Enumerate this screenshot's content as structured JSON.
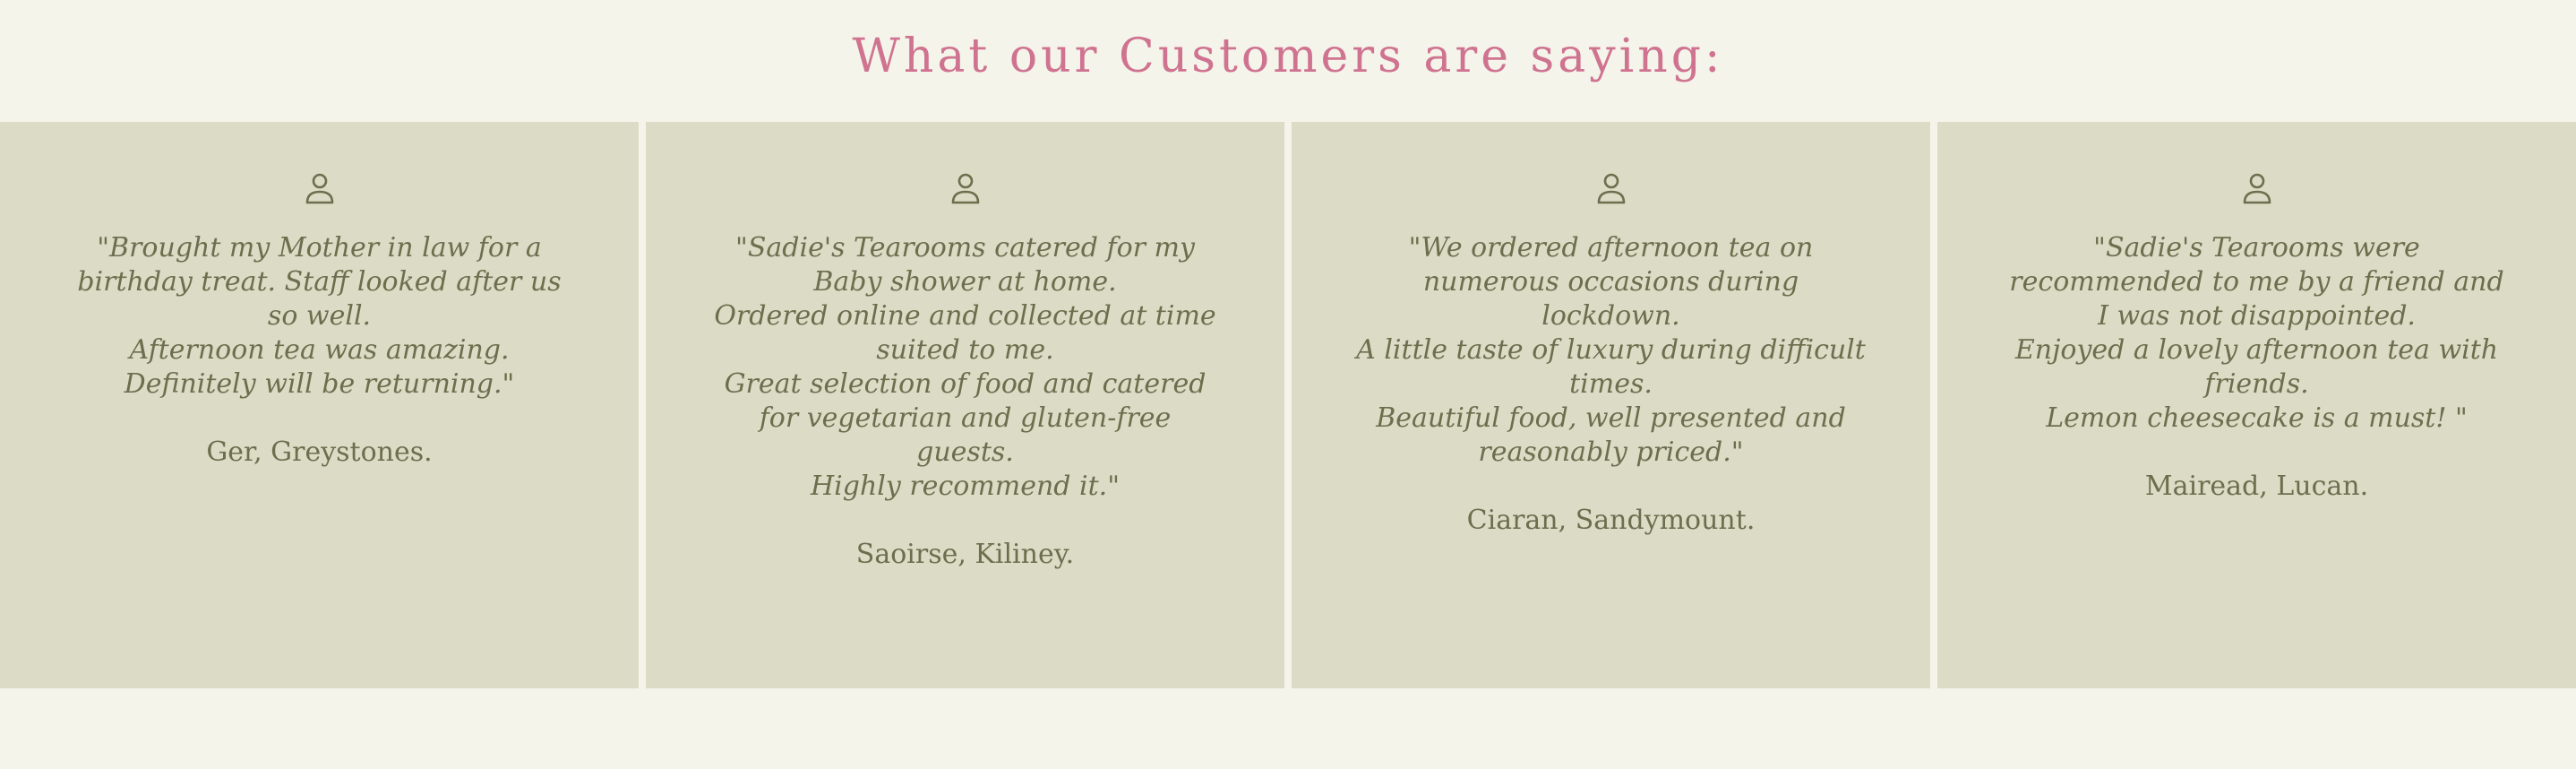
{
  "heading": "What our Customers are saying:",
  "colors": {
    "background": "#f4f4ea",
    "card_background": "#dcdbc5",
    "heading": "#cf7390",
    "text": "#6b6f4e"
  },
  "testimonials": [
    {
      "icon": "user-icon",
      "quote": "\"Brought my Mother in law for a birthday treat. Staff looked after us so well.\nAfternoon tea was amazing. Definitely will be returning.\"",
      "author": "Ger, Greystones."
    },
    {
      "icon": "user-icon",
      "quote": "\"Sadie's Tearooms catered for my Baby shower at home.\nOrdered online and collected at time suited to me.\nGreat selection of food and catered for vegetarian and gluten-free guests.\nHighly recommend it.\"",
      "author": "Saoirse, Kiliney."
    },
    {
      "icon": "user-icon",
      "quote": "\"We ordered afternoon tea on numerous occasions during lockdown.\nA little taste of luxury during difficult times.\nBeautiful food, well presented and reasonably priced.\"",
      "author": "Ciaran, Sandymount."
    },
    {
      "icon": "user-icon",
      "quote": "\"Sadie's Tearooms were recommended to me by a friend and I was not disappointed.\nEnjoyed a lovely afternoon tea with friends.\nLemon cheesecake is a must! \"",
      "author": "Mairead, Lucan."
    }
  ]
}
